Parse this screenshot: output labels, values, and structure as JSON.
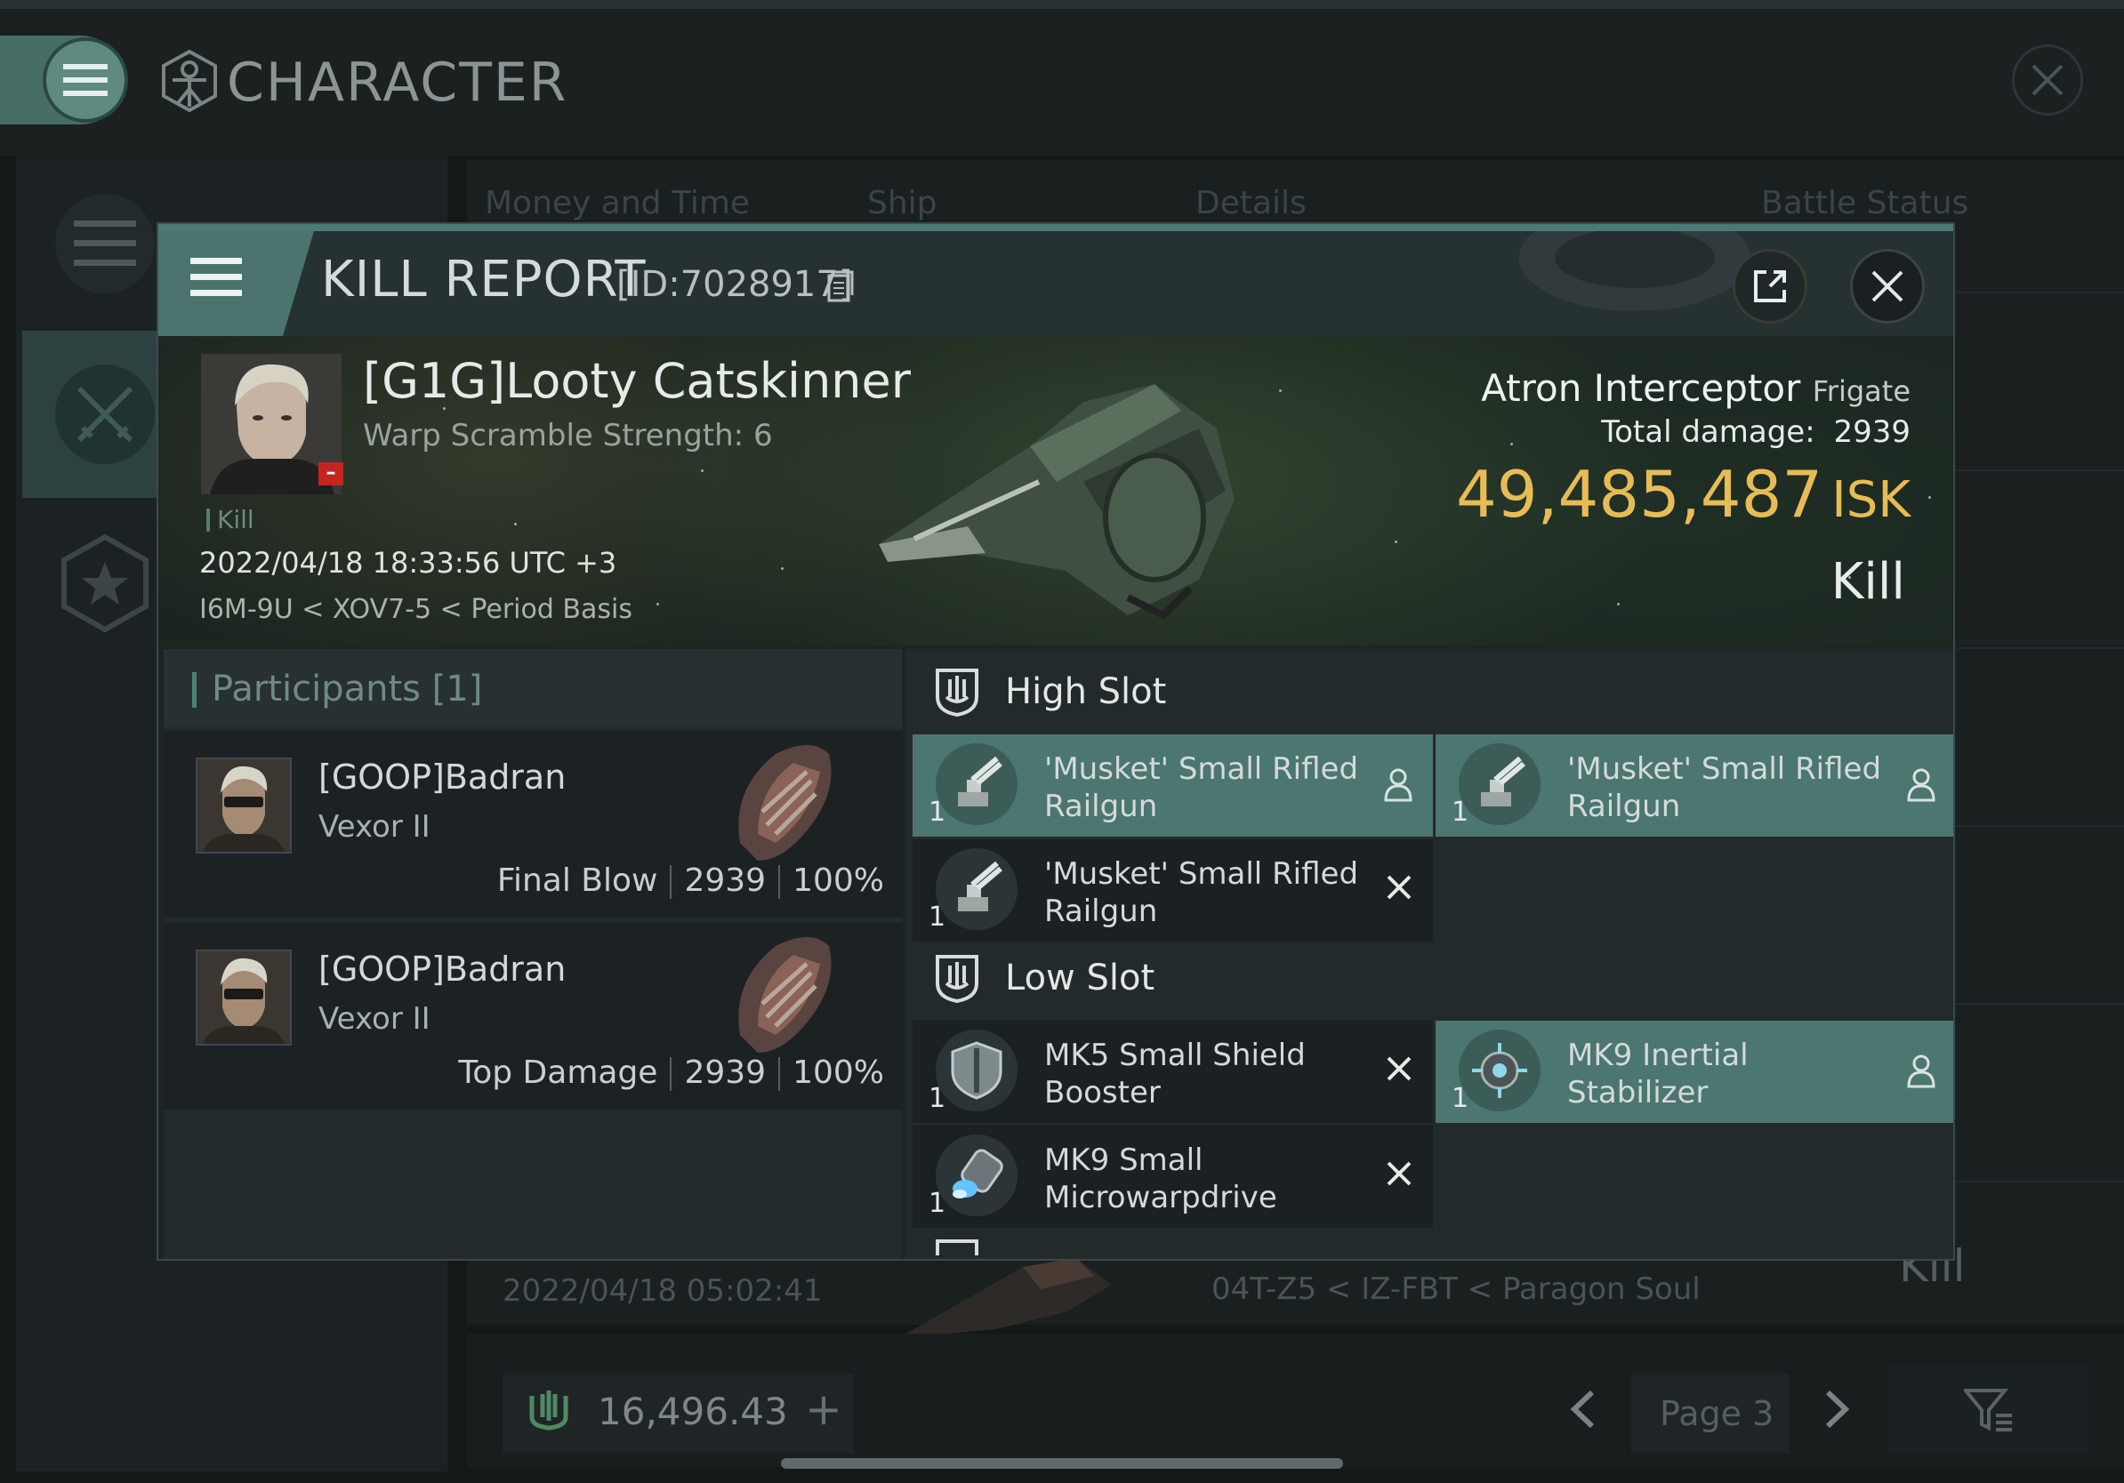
{
  "app": {
    "title": "CHARACTER"
  },
  "background_table": {
    "columns": [
      "Money and Time",
      "Ship",
      "Details",
      "Battle Status"
    ],
    "peek_row": {
      "date": "2022/04/18  05:02:41",
      "location": "04T-Z5 < IZ-FBT < Paragon Soul",
      "status": "Kill"
    }
  },
  "bottom_bar": {
    "wallet_value": "16,496.43",
    "add_symbol": "+",
    "page_label": "Page 3"
  },
  "kill_report": {
    "title": "KILL REPORT",
    "id": "[ID:7028917]",
    "victim": {
      "name": "[G1G]Looty Catskinner",
      "warp_scramble": "Warp Scramble Strength: 6",
      "tag": "Kill",
      "datetime": "2022/04/18 18:33:56 UTC +3",
      "location": "I6M-9U < XOV7-5 < Period Basis"
    },
    "ship": {
      "name": "Atron Interceptor",
      "class": "Frigate",
      "total_damage_label": "Total damage:",
      "total_damage": "2939",
      "isk_value": "49,485,487",
      "isk_unit": "ISK",
      "result": "Kill"
    },
    "participants": {
      "title": "Participants [1]",
      "items": [
        {
          "name": "[GOOP]Badran",
          "ship": "Vexor II",
          "role": "Final Blow",
          "damage": "2939",
          "percent": "100%"
        },
        {
          "name": "[GOOP]Badran",
          "ship": "Vexor II",
          "role": "Top Damage",
          "damage": "2939",
          "percent": "100%"
        }
      ]
    },
    "slots": {
      "high": {
        "label": "High Slot",
        "items": [
          {
            "name": "'Musket' Small Rifled Railgun",
            "qty": "1",
            "status": "dropped-person-icon",
            "selected": true
          },
          {
            "name": "'Musket' Small Rifled Railgun",
            "qty": "1",
            "status": "dropped-person-icon",
            "selected": true
          },
          {
            "name": "'Musket' Small Rifled Railgun",
            "qty": "1",
            "status": "destroyed-x-icon",
            "selected": false
          }
        ]
      },
      "low": {
        "label": "Low Slot",
        "items": [
          {
            "name": "MK5 Small Shield Booster",
            "qty": "1",
            "status": "destroyed-x-icon",
            "selected": false
          },
          {
            "name": "MK9 Inertial Stabilizer",
            "qty": "1",
            "status": "dropped-person-icon",
            "selected": true
          },
          {
            "name": "MK9 Small Microwarpdrive",
            "qty": "1",
            "status": "destroyed-x-icon",
            "selected": false
          }
        ]
      }
    }
  },
  "colors": {
    "accent_teal": "#4c7670",
    "isk_gold": "#e8bc55",
    "panel_bg": "#232a2b",
    "destroyed_red_badge": "#c3261f"
  }
}
